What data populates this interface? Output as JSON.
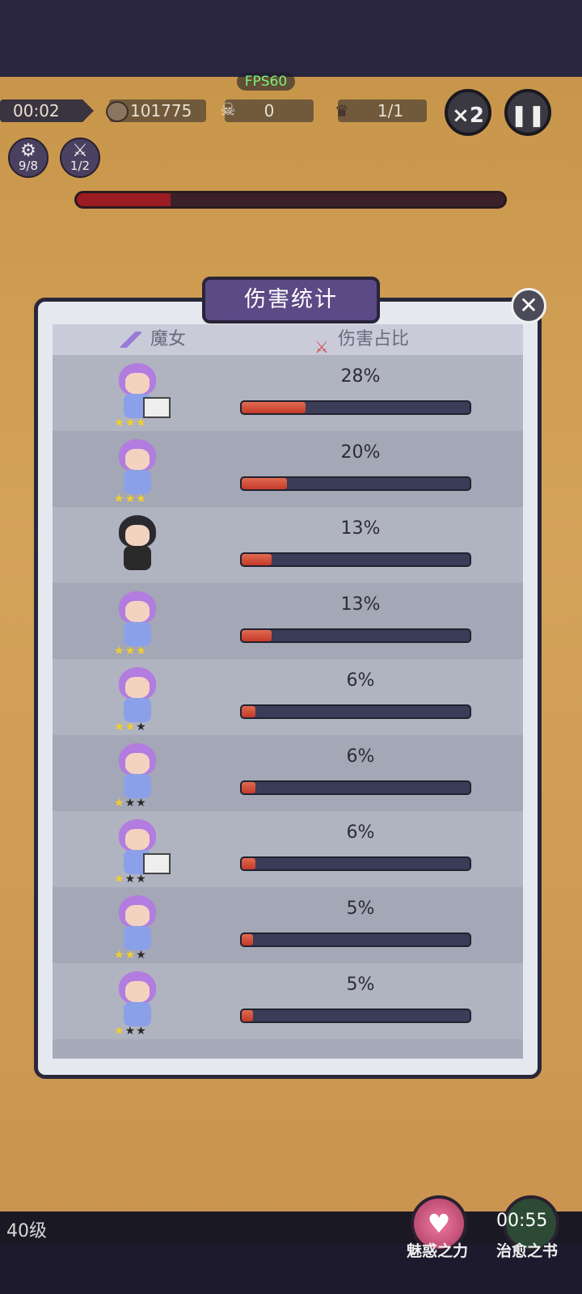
{
  "hud": {
    "fps": "FPS60",
    "timer": "00:02",
    "coins": "101775",
    "kills": "0",
    "wave": "1/1",
    "speed": "×2",
    "skill1": "9/8",
    "skill2": "1/2",
    "boss_hp_fraction": 0.22
  },
  "modal": {
    "title": "伤害统计",
    "col_witch": "魔女",
    "col_damage": "伤害占比",
    "close": "✕"
  },
  "rows": [
    {
      "pct": "28%",
      "value": 0.28,
      "stars": 3,
      "char": "witch-desk"
    },
    {
      "pct": "20%",
      "value": 0.2,
      "stars": 3,
      "char": "witch-purple"
    },
    {
      "pct": "13%",
      "value": 0.13,
      "stars": 0,
      "char": "gunner"
    },
    {
      "pct": "13%",
      "value": 0.13,
      "stars": 3,
      "char": "witch-purple"
    },
    {
      "pct": "6%",
      "value": 0.06,
      "stars": 2,
      "char": "witch-purple"
    },
    {
      "pct": "6%",
      "value": 0.06,
      "stars": 1,
      "char": "witch-purple"
    },
    {
      "pct": "6%",
      "value": 0.06,
      "stars": 1,
      "char": "witch-desk"
    },
    {
      "pct": "5%",
      "value": 0.05,
      "stars": 2,
      "char": "witch-purple"
    },
    {
      "pct": "5%",
      "value": 0.05,
      "stars": 1,
      "char": "witch-purple"
    }
  ],
  "bottom": {
    "level": "40级",
    "skill_charm": "魅惑之力",
    "skill_heal": "治愈之书",
    "cooldown": "00:55"
  },
  "colors": {
    "bar_fill": "#c53a2a",
    "bar_track": "#3a3c58",
    "star": "#f2cf2a"
  }
}
